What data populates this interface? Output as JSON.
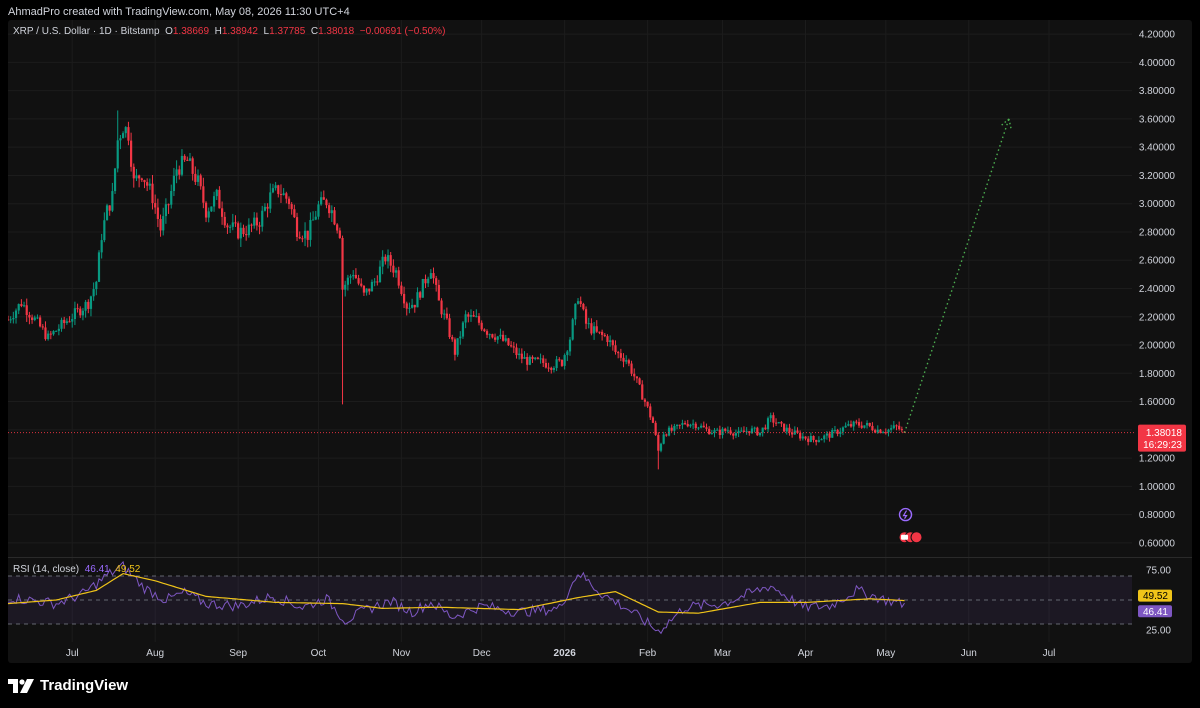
{
  "credit": "AhmadPro created with TradingView.com, May 08, 2026 11:30 UTC+4",
  "brand": {
    "name": "TradingView",
    "logo_icon": "tradingview-logo-icon"
  },
  "legend": {
    "symbol": "XRP / U.S. Dollar · 1D · Bitstamp",
    "o_label": "O",
    "o": "1.38669",
    "h_label": "H",
    "h": "1.38942",
    "l_label": "L",
    "l": "1.37785",
    "c_label": "C",
    "c": "1.38018",
    "change": "−0.00691 (−0.50%)"
  },
  "price_badge": {
    "price": "1.38018",
    "countdown": "16:29:23"
  },
  "rsi_legend": {
    "label": "RSI (14, close)",
    "rsi": "46.41",
    "ma": "49.52"
  },
  "rsi_badges": {
    "ma": "49.52",
    "rsi": "46.41"
  },
  "colors": {
    "up": "#089981",
    "down": "#f23645",
    "rsi_line": "#7e57c2",
    "rsi_ma": "#f0c419",
    "projection": "#4caf50",
    "background": "#111111"
  },
  "chart_data": [
    {
      "type": "candlestick",
      "title": "XRP / U.S. Dollar · 1D · Bitstamp",
      "ylim": [
        0.5,
        4.3
      ],
      "y_ticks": [
        "4.20000",
        "4.00000",
        "3.80000",
        "3.60000",
        "3.40000",
        "3.20000",
        "3.00000",
        "2.80000",
        "2.60000",
        "2.40000",
        "2.20000",
        "2.00000",
        "1.80000",
        "1.60000",
        "1.40000",
        "1.20000",
        "1.00000",
        "0.80000",
        "0.60000"
      ],
      "x_tick_labels": [
        "Jul",
        "Aug",
        "Sep",
        "Oct",
        "Nov",
        "Dec",
        "2026",
        "Feb",
        "Mar",
        "Apr",
        "May",
        "Jun",
        "Jul"
      ],
      "x_tick_dates": [
        "2025-07-01",
        "2025-08-01",
        "2025-09-01",
        "2025-10-01",
        "2025-11-01",
        "2025-12-01",
        "2026-01-01",
        "2026-02-01",
        "2026-03-01",
        "2026-04-01",
        "2026-05-01",
        "2026-06-01",
        "2026-07-01"
      ],
      "x_range": [
        "2025-06-07",
        "2026-08-01"
      ],
      "close_path": [
        [
          "2025-06-07",
          2.18
        ],
        [
          "2025-06-12",
          2.3
        ],
        [
          "2025-06-17",
          2.18
        ],
        [
          "2025-06-22",
          2.05
        ],
        [
          "2025-06-27",
          2.14
        ],
        [
          "2025-07-02",
          2.22
        ],
        [
          "2025-07-07",
          2.3
        ],
        [
          "2025-07-10",
          2.45
        ],
        [
          "2025-07-12",
          2.78
        ],
        [
          "2025-07-14",
          2.95
        ],
        [
          "2025-07-16",
          3.05
        ],
        [
          "2025-07-18",
          3.45
        ],
        [
          "2025-07-20",
          3.55
        ],
        [
          "2025-07-22",
          3.5
        ],
        [
          "2025-07-24",
          3.15
        ],
        [
          "2025-07-27",
          3.22
        ],
        [
          "2025-07-31",
          3.05
        ],
        [
          "2025-08-03",
          2.82
        ],
        [
          "2025-08-06",
          3.0
        ],
        [
          "2025-08-09",
          3.25
        ],
        [
          "2025-08-13",
          3.3
        ],
        [
          "2025-08-17",
          3.15
        ],
        [
          "2025-08-20",
          2.95
        ],
        [
          "2025-08-24",
          3.05
        ],
        [
          "2025-08-28",
          2.85
        ],
        [
          "2025-09-01",
          2.8
        ],
        [
          "2025-09-05",
          2.82
        ],
        [
          "2025-09-09",
          2.88
        ],
        [
          "2025-09-13",
          3.05
        ],
        [
          "2025-09-16",
          3.1
        ],
        [
          "2025-09-20",
          3.02
        ],
        [
          "2025-09-23",
          2.82
        ],
        [
          "2025-09-27",
          2.78
        ],
        [
          "2025-10-01",
          2.98
        ],
        [
          "2025-10-04",
          3.02
        ],
        [
          "2025-10-06",
          2.95
        ],
        [
          "2025-10-09",
          2.8
        ],
        [
          "2025-10-10",
          2.4
        ],
        [
          "2025-10-14",
          2.52
        ],
        [
          "2025-10-18",
          2.35
        ],
        [
          "2025-10-22",
          2.45
        ],
        [
          "2025-10-26",
          2.62
        ],
        [
          "2025-10-30",
          2.52
        ],
        [
          "2025-11-03",
          2.28
        ],
        [
          "2025-11-06",
          2.3
        ],
        [
          "2025-11-09",
          2.42
        ],
        [
          "2025-11-12",
          2.55
        ],
        [
          "2025-11-15",
          2.3
        ],
        [
          "2025-11-18",
          2.15
        ],
        [
          "2025-11-21",
          1.95
        ],
        [
          "2025-11-25",
          2.2
        ],
        [
          "2025-11-29",
          2.18
        ],
        [
          "2025-12-03",
          2.1
        ],
        [
          "2025-12-07",
          2.06
        ],
        [
          "2025-12-11",
          2.0
        ],
        [
          "2025-12-15",
          1.92
        ],
        [
          "2025-12-19",
          1.88
        ],
        [
          "2025-12-23",
          1.88
        ],
        [
          "2025-12-27",
          1.86
        ],
        [
          "2025-12-31",
          1.88
        ],
        [
          "2026-01-03",
          2.05
        ],
        [
          "2026-01-06",
          2.35
        ],
        [
          "2026-01-09",
          2.15
        ],
        [
          "2026-01-13",
          2.08
        ],
        [
          "2026-01-17",
          2.05
        ],
        [
          "2026-01-20",
          1.95
        ],
        [
          "2026-01-24",
          1.9
        ],
        [
          "2026-01-27",
          1.78
        ],
        [
          "2026-01-31",
          1.6
        ],
        [
          "2026-02-03",
          1.45
        ],
        [
          "2026-02-05",
          1.25
        ],
        [
          "2026-02-07",
          1.38
        ],
        [
          "2026-02-11",
          1.4
        ],
        [
          "2026-02-15",
          1.45
        ],
        [
          "2026-02-19",
          1.44
        ],
        [
          "2026-02-23",
          1.4
        ],
        [
          "2026-02-27",
          1.38
        ],
        [
          "2026-03-03",
          1.4
        ],
        [
          "2026-03-07",
          1.37
        ],
        [
          "2026-03-11",
          1.4
        ],
        [
          "2026-03-15",
          1.38
        ],
        [
          "2026-03-19",
          1.48
        ],
        [
          "2026-03-23",
          1.42
        ],
        [
          "2026-03-27",
          1.38
        ],
        [
          "2026-03-31",
          1.35
        ],
        [
          "2026-04-04",
          1.33
        ],
        [
          "2026-04-08",
          1.35
        ],
        [
          "2026-04-12",
          1.38
        ],
        [
          "2026-04-16",
          1.42
        ],
        [
          "2026-04-20",
          1.44
        ],
        [
          "2026-04-24",
          1.43
        ],
        [
          "2026-04-28",
          1.4
        ],
        [
          "2026-05-02",
          1.4
        ],
        [
          "2026-05-05",
          1.42
        ],
        [
          "2026-05-08",
          1.38
        ]
      ],
      "highlighted_extremes": [
        [
          "2025-10-10",
          1.58
        ],
        [
          "2025-07-18",
          3.66
        ],
        [
          "2026-02-05",
          1.12
        ]
      ],
      "last_price": 1.38018,
      "projection": {
        "from": [
          "2026-05-08",
          1.38
        ],
        "to": [
          "2026-06-16",
          3.6
        ]
      }
    },
    {
      "type": "line",
      "title": "RSI (14, close)",
      "ylim": [
        15,
        85
      ],
      "y_ticks": [
        "75.00",
        "25.00"
      ],
      "band": [
        30,
        70
      ],
      "midline": 50,
      "series": [
        {
          "name": "RSI",
          "values": [
            [
              "2025-06-07",
              52
            ],
            [
              "2025-06-15",
              50
            ],
            [
              "2025-06-25",
              47
            ],
            [
              "2025-07-05",
              55
            ],
            [
              "2025-07-15",
              72
            ],
            [
              "2025-07-20",
              78
            ],
            [
              "2025-07-28",
              60
            ],
            [
              "2025-08-05",
              50
            ],
            [
              "2025-08-12",
              56
            ],
            [
              "2025-08-20",
              47
            ],
            [
              "2025-09-01",
              45
            ],
            [
              "2025-09-14",
              53
            ],
            [
              "2025-09-25",
              44
            ],
            [
              "2025-10-04",
              51
            ],
            [
              "2025-10-11",
              33
            ],
            [
              "2025-10-20",
              43
            ],
            [
              "2025-10-28",
              49
            ],
            [
              "2025-11-05",
              40
            ],
            [
              "2025-11-12",
              48
            ],
            [
              "2025-11-20",
              36
            ],
            [
              "2025-12-01",
              45
            ],
            [
              "2025-12-15",
              40
            ],
            [
              "2025-12-30",
              43
            ],
            [
              "2026-01-06",
              73
            ],
            [
              "2026-01-15",
              55
            ],
            [
              "2026-01-25",
              42
            ],
            [
              "2026-02-05",
              24
            ],
            [
              "2026-02-15",
              44
            ],
            [
              "2026-03-01",
              47
            ],
            [
              "2026-03-19",
              62
            ],
            [
              "2026-03-31",
              44
            ],
            [
              "2026-04-10",
              45
            ],
            [
              "2026-04-20",
              58
            ],
            [
              "2026-05-01",
              50
            ],
            [
              "2026-05-08",
              46.41
            ]
          ]
        },
        {
          "name": "MA",
          "values": [
            [
              "2025-06-07",
              47
            ],
            [
              "2025-06-25",
              50
            ],
            [
              "2025-07-10",
              58
            ],
            [
              "2025-07-20",
              72
            ],
            [
              "2025-08-01",
              66
            ],
            [
              "2025-08-20",
              53
            ],
            [
              "2025-09-15",
              48
            ],
            [
              "2025-10-10",
              47
            ],
            [
              "2025-10-25",
              43
            ],
            [
              "2025-11-15",
              44
            ],
            [
              "2025-12-15",
              42
            ],
            [
              "2026-01-06",
              52
            ],
            [
              "2026-01-20",
              57
            ],
            [
              "2026-02-05",
              40
            ],
            [
              "2026-02-20",
              39
            ],
            [
              "2026-03-15",
              48
            ],
            [
              "2026-04-01",
              48
            ],
            [
              "2026-04-25",
              51
            ],
            [
              "2026-05-08",
              49.52
            ]
          ]
        }
      ]
    }
  ]
}
